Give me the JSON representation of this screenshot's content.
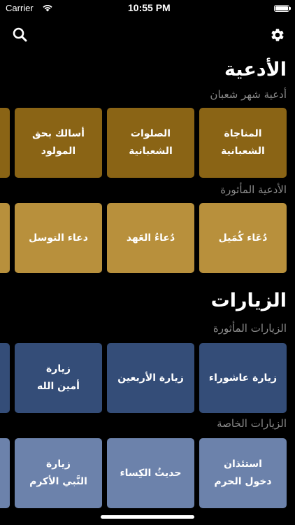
{
  "status_bar": {
    "carrier": "Carrier",
    "time": "10:55 PM"
  },
  "header": {
    "search_icon": "search-icon",
    "settings_icon": "gear-icon"
  },
  "duas": {
    "title": "الأدعية",
    "sections": [
      {
        "subtitle": "أدعية شهر شعبان",
        "color": "#8a6415",
        "cards": [
          {
            "label": "المناجاة الشعبانية"
          },
          {
            "label": "الصلوات\nالشعبانية"
          },
          {
            "label": "أسالك بحق المولود"
          },
          {
            "label": ""
          }
        ]
      },
      {
        "subtitle": "الأدعية المأثورة",
        "color": "#b8903c",
        "cards": [
          {
            "label": "دُعَاء كُمَيل"
          },
          {
            "label": "دُعاءُ العَهد"
          },
          {
            "label": "دعاء التوسل"
          },
          {
            "label": ""
          }
        ]
      }
    ]
  },
  "ziyarat": {
    "title": "الزيارات",
    "sections": [
      {
        "subtitle": "الزيارات المأثورة",
        "color": "#344d78",
        "cards": [
          {
            "label": "زيارة عاشوراء"
          },
          {
            "label": "زيارة الأربعين"
          },
          {
            "label": "زيارة\nأمين الله"
          },
          {
            "label": ""
          }
        ]
      },
      {
        "subtitle": "الزيارات الخاصة",
        "color": "#6c82ab",
        "cards": [
          {
            "label": "استئذان\nدخول الحرم"
          },
          {
            "label": "حديثُ الكِساء"
          },
          {
            "label": "زيارة\nالنَّبي الأكرم"
          },
          {
            "label": ""
          }
        ]
      }
    ]
  }
}
